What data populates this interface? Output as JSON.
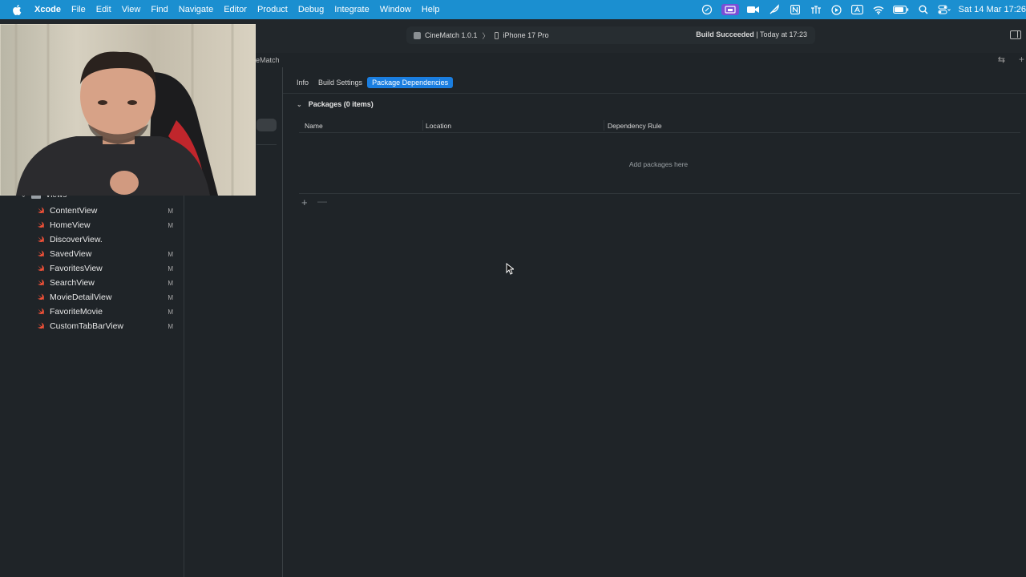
{
  "menubar": {
    "app": "Xcode",
    "items": [
      "File",
      "Edit",
      "View",
      "Find",
      "Navigate",
      "Editor",
      "Product",
      "Debug",
      "Integrate",
      "Window",
      "Help"
    ],
    "clock": "Sat 14 Mar  17:26",
    "status_icons": [
      "edit-icon",
      "screen-record-icon",
      "camera-icon",
      "feather-icon",
      "notion-icon",
      "network-icon",
      "play-icon",
      "input-a-icon",
      "wifi-icon",
      "battery-icon",
      "search-icon",
      "control-center-icon"
    ]
  },
  "toolbar": {
    "scheme_name": "CineMatch 1.0.1",
    "chevron": "〉",
    "device": "iPhone 17 Pro",
    "build_status": "Build Succeeded",
    "build_time": "| Today at 17:23"
  },
  "editor": {
    "breadcrumb": "eMatch"
  },
  "tabs": [
    {
      "label": "Info",
      "active": false
    },
    {
      "label": "Build Settings",
      "active": false
    },
    {
      "label": "Package Dependencies",
      "active": true
    }
  ],
  "packages": {
    "header": "Packages (0 items)",
    "columns": [
      "Name",
      "Location",
      "Dependency Rule"
    ],
    "empty_message": "Add packages here",
    "add_symbol": "+",
    "remove_symbol": "—"
  },
  "navigator": {
    "folder": "Views",
    "files": [
      {
        "name": "ContentView",
        "badge": "M"
      },
      {
        "name": "HomeView",
        "badge": "M"
      },
      {
        "name": "DiscoverView.",
        "badge": ""
      },
      {
        "name": "SavedView",
        "badge": "M"
      },
      {
        "name": "FavoritesView",
        "badge": "M"
      },
      {
        "name": "SearchView",
        "badge": "M"
      },
      {
        "name": "MovieDetailView",
        "badge": "M"
      },
      {
        "name": "FavoriteMovie",
        "badge": "M"
      },
      {
        "name": "CustomTabBarView",
        "badge": "M"
      }
    ]
  },
  "colors": {
    "menubar": "#1b8fd0",
    "accent": "#1a7ee0",
    "background": "#1f2428",
    "swift": "#f05138"
  }
}
